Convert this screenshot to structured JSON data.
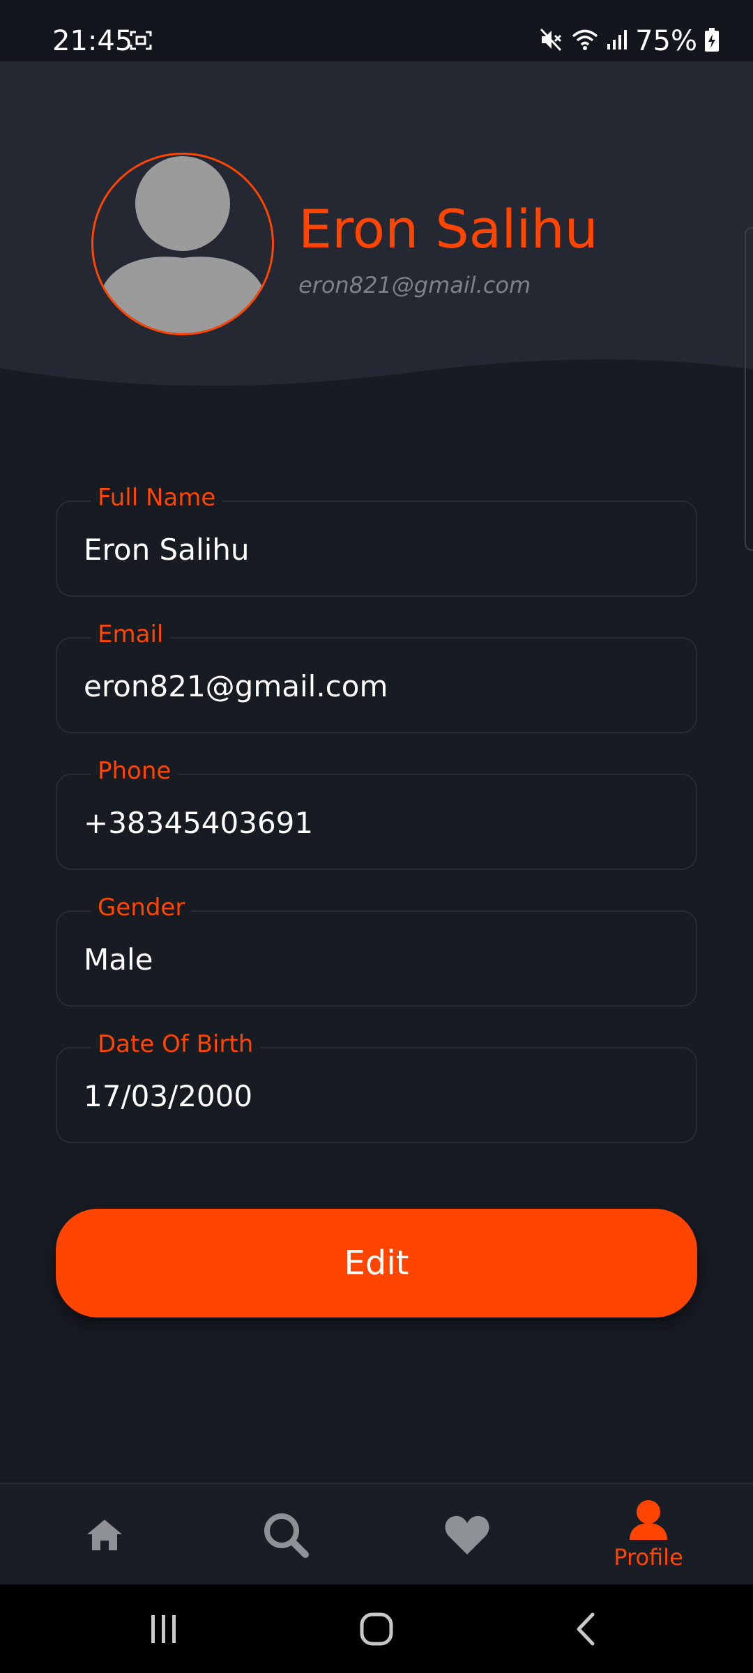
{
  "status_bar": {
    "time": "21:45",
    "battery": "75%",
    "icons": [
      "screen-record-icon",
      "mute-icon",
      "wifi-icon",
      "signal-icon",
      "battery-charging-icon"
    ]
  },
  "profile": {
    "name": "Eron Salihu",
    "email": "eron821@gmail.com",
    "avatar_icon": "default-avatar-icon"
  },
  "fields": [
    {
      "label": "Full Name",
      "value": "Eron Salihu"
    },
    {
      "label": "Email",
      "value": "eron821@gmail.com"
    },
    {
      "label": "Phone",
      "value": "+38345403691"
    },
    {
      "label": "Gender",
      "value": "Male"
    },
    {
      "label": "Date Of Birth",
      "value": "17/03/2000"
    }
  ],
  "edit_button": {
    "label": "Edit"
  },
  "bottom_nav": {
    "items": [
      {
        "icon": "home-icon",
        "label": ""
      },
      {
        "icon": "search-icon",
        "label": ""
      },
      {
        "icon": "heart-icon",
        "label": ""
      },
      {
        "icon": "profile-icon",
        "label": "Profile",
        "active": true
      }
    ]
  },
  "system_nav": {
    "icons": [
      "recent-apps-icon",
      "home-button-icon",
      "back-icon"
    ]
  },
  "colors": {
    "accent": "#ff4500",
    "background": "#171b22",
    "header_background": "#232833",
    "inactive_icon": "#8e9297"
  }
}
